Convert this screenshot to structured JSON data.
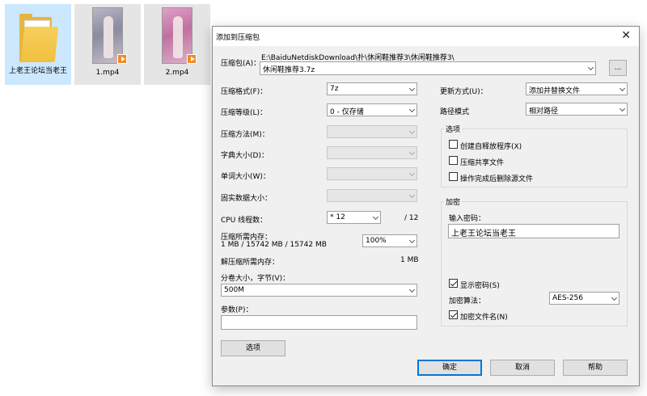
{
  "desktop": {
    "items": [
      {
        "label": "上老王论坛当老王"
      },
      {
        "label": "1.mp4"
      },
      {
        "label": "2.mp4"
      }
    ]
  },
  "dialog": {
    "title": "添加到压缩包",
    "archive_label": "压缩包(A)：",
    "archive_path": "E:\\BaiduNetdiskDownload\\扑\\休闲鞋推荐3\\休闲鞋推荐3\\",
    "archive_name": "休闲鞋推荐3.7z",
    "browse_label": "...",
    "format_label": "压缩格式(F)：",
    "format_value": "7z",
    "level_label": "压缩等级(L)：",
    "level_value": "0 - 仅存储",
    "method_label": "压缩方法(M)：",
    "dict_label": "字典大小(D)：",
    "word_label": "单词大小(W)：",
    "solid_label": "固实数据大小：",
    "cpu_label": "CPU 线程数：",
    "cpu_value": "* 12",
    "cpu_total": "/ 12",
    "mem_comp_label": "压缩所需内存：",
    "mem_comp_value": "1 MB / 15742 MB / 15742 MB",
    "mem_percent": "100%",
    "mem_decomp_label": "解压缩所需内存：",
    "mem_decomp_value": "1 MB",
    "volume_label": "分卷大小，字节(V)：",
    "volume_value": "500M",
    "params_label": "参数(P)：",
    "params_value": "",
    "options_button": "选项",
    "update_label": "更新方式(U)：",
    "update_value": "添加并替换文件",
    "path_label": "路径模式",
    "path_value": "相对路径",
    "options_group": "选项",
    "opt_sfx": "创建自释放程序(X)",
    "opt_shared": "压缩共享文件",
    "opt_delete": "操作完成后删除源文件",
    "encrypt_group": "加密",
    "password_label": "输入密码：",
    "password_value": "上老王论坛当老王",
    "show_password": "显示密码(S)",
    "enc_method_label": "加密算法：",
    "enc_method_value": "AES-256",
    "encrypt_names": "加密文件名(N)",
    "ok_button": "确定",
    "cancel_button": "取消",
    "help_button": "帮助"
  }
}
